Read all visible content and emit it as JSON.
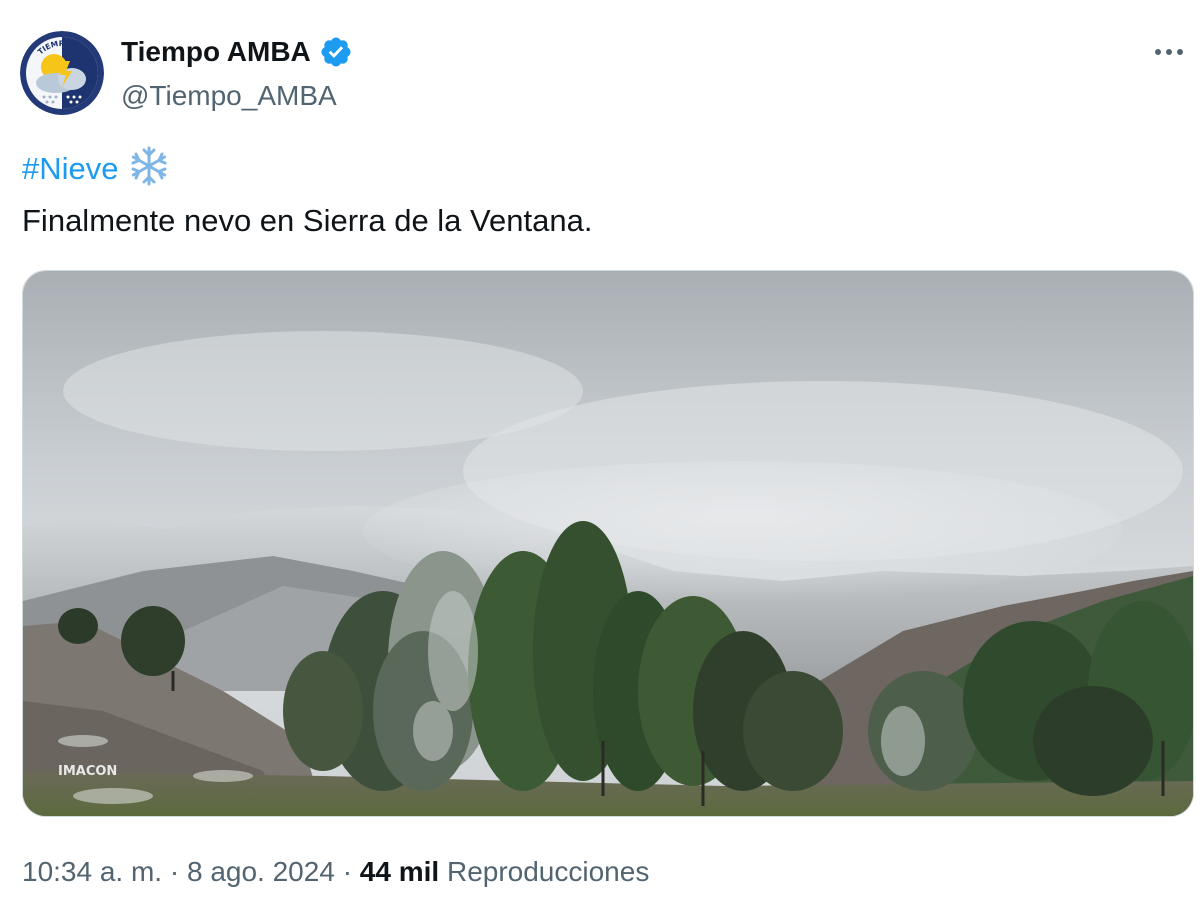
{
  "author": {
    "display_name": "Tiempo AMBA",
    "handle": "@Tiempo_AMBA",
    "verified": true,
    "avatar_text": "TIEMPO AMBA",
    "avatar_icon": "sun-cloud-snow-icon"
  },
  "tweet": {
    "hashtag": "#Nieve",
    "emoji": "❄️",
    "text": "Finalmente nevo en Sierra de la Ventana.",
    "media_watermark": "IMACON"
  },
  "meta": {
    "time": "10:34 a. m.",
    "separator": "·",
    "date": "8 ago. 2024",
    "views_count": "44 mil",
    "views_label": "Reproducciones"
  },
  "colors": {
    "link": "#1d9bf0",
    "text": "#0f1419",
    "secondary": "#536471",
    "verified": "#1d9bf0"
  },
  "icons": {
    "more": "more-horizontal-icon",
    "verified": "verified-badge-icon",
    "snowflake": "snowflake-icon"
  }
}
